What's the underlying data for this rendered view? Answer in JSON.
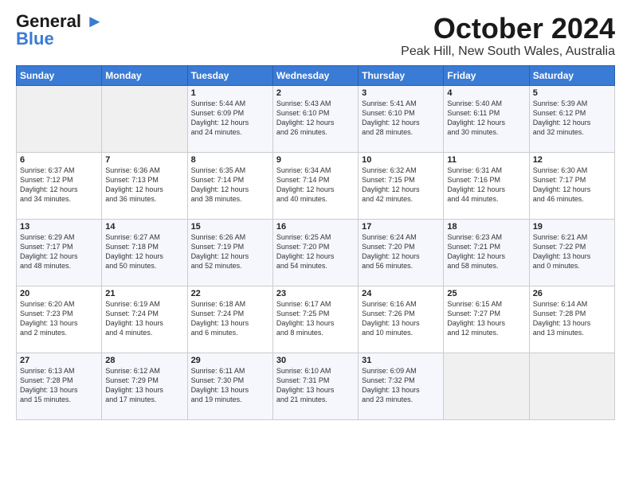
{
  "logo": {
    "line1": "General",
    "line2": "Blue"
  },
  "title": "October 2024",
  "location": "Peak Hill, New South Wales, Australia",
  "days_header": [
    "Sunday",
    "Monday",
    "Tuesday",
    "Wednesday",
    "Thursday",
    "Friday",
    "Saturday"
  ],
  "weeks": [
    [
      {
        "day": "",
        "content": ""
      },
      {
        "day": "",
        "content": ""
      },
      {
        "day": "1",
        "content": "Sunrise: 5:44 AM\nSunset: 6:09 PM\nDaylight: 12 hours\nand 24 minutes."
      },
      {
        "day": "2",
        "content": "Sunrise: 5:43 AM\nSunset: 6:10 PM\nDaylight: 12 hours\nand 26 minutes."
      },
      {
        "day": "3",
        "content": "Sunrise: 5:41 AM\nSunset: 6:10 PM\nDaylight: 12 hours\nand 28 minutes."
      },
      {
        "day": "4",
        "content": "Sunrise: 5:40 AM\nSunset: 6:11 PM\nDaylight: 12 hours\nand 30 minutes."
      },
      {
        "day": "5",
        "content": "Sunrise: 5:39 AM\nSunset: 6:12 PM\nDaylight: 12 hours\nand 32 minutes."
      }
    ],
    [
      {
        "day": "6",
        "content": "Sunrise: 6:37 AM\nSunset: 7:12 PM\nDaylight: 12 hours\nand 34 minutes."
      },
      {
        "day": "7",
        "content": "Sunrise: 6:36 AM\nSunset: 7:13 PM\nDaylight: 12 hours\nand 36 minutes."
      },
      {
        "day": "8",
        "content": "Sunrise: 6:35 AM\nSunset: 7:14 PM\nDaylight: 12 hours\nand 38 minutes."
      },
      {
        "day": "9",
        "content": "Sunrise: 6:34 AM\nSunset: 7:14 PM\nDaylight: 12 hours\nand 40 minutes."
      },
      {
        "day": "10",
        "content": "Sunrise: 6:32 AM\nSunset: 7:15 PM\nDaylight: 12 hours\nand 42 minutes."
      },
      {
        "day": "11",
        "content": "Sunrise: 6:31 AM\nSunset: 7:16 PM\nDaylight: 12 hours\nand 44 minutes."
      },
      {
        "day": "12",
        "content": "Sunrise: 6:30 AM\nSunset: 7:17 PM\nDaylight: 12 hours\nand 46 minutes."
      }
    ],
    [
      {
        "day": "13",
        "content": "Sunrise: 6:29 AM\nSunset: 7:17 PM\nDaylight: 12 hours\nand 48 minutes."
      },
      {
        "day": "14",
        "content": "Sunrise: 6:27 AM\nSunset: 7:18 PM\nDaylight: 12 hours\nand 50 minutes."
      },
      {
        "day": "15",
        "content": "Sunrise: 6:26 AM\nSunset: 7:19 PM\nDaylight: 12 hours\nand 52 minutes."
      },
      {
        "day": "16",
        "content": "Sunrise: 6:25 AM\nSunset: 7:20 PM\nDaylight: 12 hours\nand 54 minutes."
      },
      {
        "day": "17",
        "content": "Sunrise: 6:24 AM\nSunset: 7:20 PM\nDaylight: 12 hours\nand 56 minutes."
      },
      {
        "day": "18",
        "content": "Sunrise: 6:23 AM\nSunset: 7:21 PM\nDaylight: 12 hours\nand 58 minutes."
      },
      {
        "day": "19",
        "content": "Sunrise: 6:21 AM\nSunset: 7:22 PM\nDaylight: 13 hours\nand 0 minutes."
      }
    ],
    [
      {
        "day": "20",
        "content": "Sunrise: 6:20 AM\nSunset: 7:23 PM\nDaylight: 13 hours\nand 2 minutes."
      },
      {
        "day": "21",
        "content": "Sunrise: 6:19 AM\nSunset: 7:24 PM\nDaylight: 13 hours\nand 4 minutes."
      },
      {
        "day": "22",
        "content": "Sunrise: 6:18 AM\nSunset: 7:24 PM\nDaylight: 13 hours\nand 6 minutes."
      },
      {
        "day": "23",
        "content": "Sunrise: 6:17 AM\nSunset: 7:25 PM\nDaylight: 13 hours\nand 8 minutes."
      },
      {
        "day": "24",
        "content": "Sunrise: 6:16 AM\nSunset: 7:26 PM\nDaylight: 13 hours\nand 10 minutes."
      },
      {
        "day": "25",
        "content": "Sunrise: 6:15 AM\nSunset: 7:27 PM\nDaylight: 13 hours\nand 12 minutes."
      },
      {
        "day": "26",
        "content": "Sunrise: 6:14 AM\nSunset: 7:28 PM\nDaylight: 13 hours\nand 13 minutes."
      }
    ],
    [
      {
        "day": "27",
        "content": "Sunrise: 6:13 AM\nSunset: 7:28 PM\nDaylight: 13 hours\nand 15 minutes."
      },
      {
        "day": "28",
        "content": "Sunrise: 6:12 AM\nSunset: 7:29 PM\nDaylight: 13 hours\nand 17 minutes."
      },
      {
        "day": "29",
        "content": "Sunrise: 6:11 AM\nSunset: 7:30 PM\nDaylight: 13 hours\nand 19 minutes."
      },
      {
        "day": "30",
        "content": "Sunrise: 6:10 AM\nSunset: 7:31 PM\nDaylight: 13 hours\nand 21 minutes."
      },
      {
        "day": "31",
        "content": "Sunrise: 6:09 AM\nSunset: 7:32 PM\nDaylight: 13 hours\nand 23 minutes."
      },
      {
        "day": "",
        "content": ""
      },
      {
        "day": "",
        "content": ""
      }
    ]
  ]
}
